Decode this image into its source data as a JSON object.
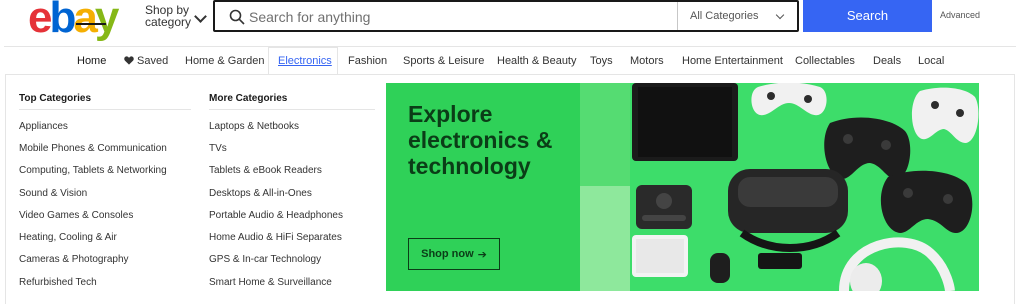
{
  "header": {
    "logo_letters": [
      "e",
      "b",
      "a",
      "y"
    ],
    "logo_colors": [
      "#e53238",
      "#0064d2",
      "#f5af02",
      "#86b817"
    ],
    "shop_by_category": "Shop by category",
    "search_placeholder": "Search for anything",
    "category_select": "All Categories",
    "search_button": "Search",
    "advanced": "Advanced"
  },
  "nav": {
    "items": [
      "Home",
      "Saved",
      "Home & Garden",
      "Electronics",
      "Fashion",
      "Sports & Leisure",
      "Health & Beauty",
      "Toys",
      "Motors",
      "Home Entertainment",
      "Collectables",
      "Deals",
      "Local"
    ],
    "active": "Electronics"
  },
  "menu": {
    "top_categories": {
      "title": "Top Categories",
      "items": [
        "Appliances",
        "Mobile Phones & Communication",
        "Computing, Tablets & Networking",
        "Sound & Vision",
        "Video Games & Consoles",
        "Heating, Cooling & Air",
        "Cameras & Photography",
        "Refurbished Tech"
      ]
    },
    "more_categories": {
      "title": "More Categories",
      "items": [
        "Laptops & Netbooks",
        "TVs",
        "Tablets & eBook Readers",
        "Desktops & All-in-Ones",
        "Portable Audio & Headphones",
        "Home Audio & HiFi Separates",
        "GPS & In-car Technology",
        "Smart Home & Surveillance"
      ]
    }
  },
  "promo": {
    "title": "Explore electronics & technology",
    "button": "Shop now",
    "button_arrow": "➔",
    "bg_color": "#2fd158",
    "text_color": "#0b3d17"
  },
  "colors": {
    "accent": "#3665f3"
  }
}
